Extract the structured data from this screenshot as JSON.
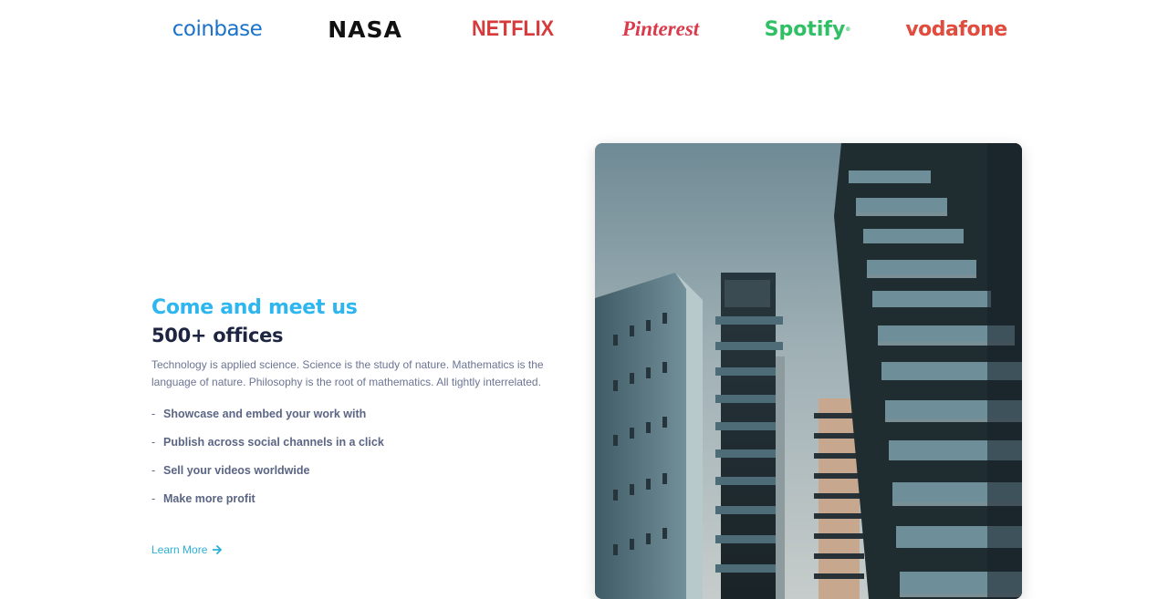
{
  "logos": {
    "coinbase": "coinbase",
    "nasa": "NASA",
    "netflix": "NETFLIX",
    "pinterest": "Pinterest",
    "spotify": "Spotify",
    "vodafone": "vodafone"
  },
  "section": {
    "subtitle": "Come and meet us",
    "title": "500+ offices",
    "description": "Technology is applied science. Science is the study of nature. Mathematics is the language of nature. Philosophy is the root of mathematics. All tightly interrelated.",
    "features": [
      "Showcase and embed your work with",
      "Publish across social channels in a click",
      "Sell your videos worldwide",
      "Make more profit"
    ],
    "learn_more": "Learn More",
    "arrow_icon": "arrow-right-icon"
  },
  "colors": {
    "accent": "#2eb6ef",
    "heading": "#1e2540",
    "body_text": "#6b7593",
    "link": "#2ab0d8"
  }
}
